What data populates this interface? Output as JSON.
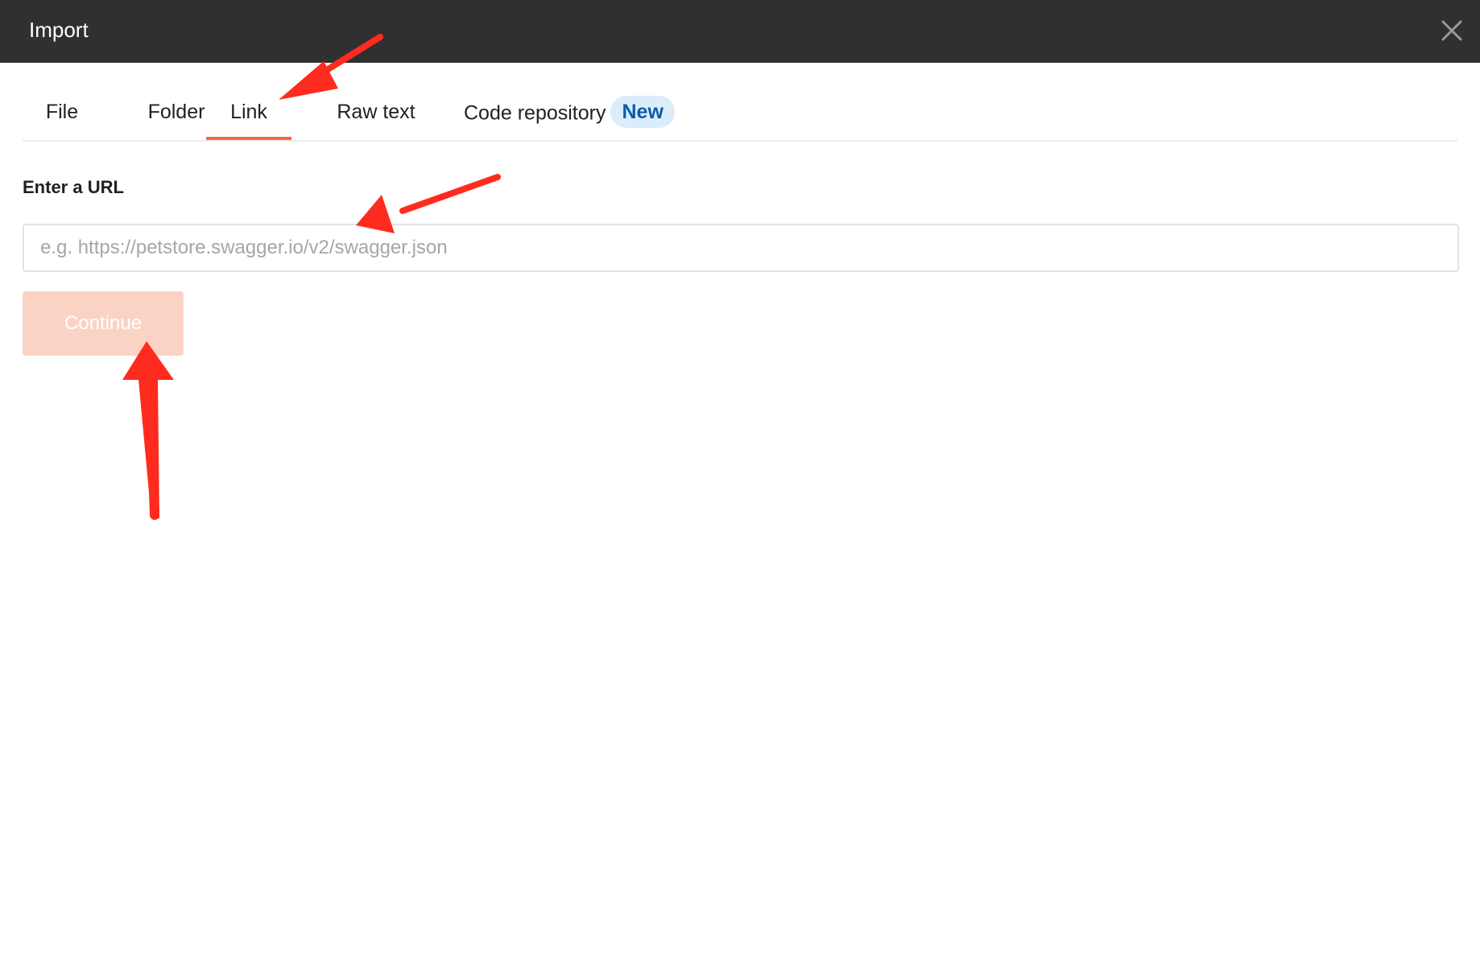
{
  "dialog": {
    "title": "Import",
    "close_icon": "close-icon"
  },
  "tabs": [
    {
      "label": "File",
      "active": false
    },
    {
      "label": "Folder",
      "active": false
    },
    {
      "label": "Link",
      "active": true
    },
    {
      "label": "Raw text",
      "active": false
    },
    {
      "label": "Code repository",
      "active": false,
      "badge": "New"
    }
  ],
  "form": {
    "url_label": "Enter a URL",
    "url_placeholder": "e.g. https://petstore.swagger.io/v2/swagger.json",
    "url_value": "",
    "continue_label": "Continue",
    "continue_disabled": true
  },
  "colors": {
    "titlebar_bg": "#303030",
    "tab_underline": "#f26b3a",
    "badge_bg": "#dbecfb",
    "badge_text": "#0b5ba9",
    "button_disabled_bg": "#fbd3c5",
    "annotation_arrow": "#ff2b1f"
  }
}
